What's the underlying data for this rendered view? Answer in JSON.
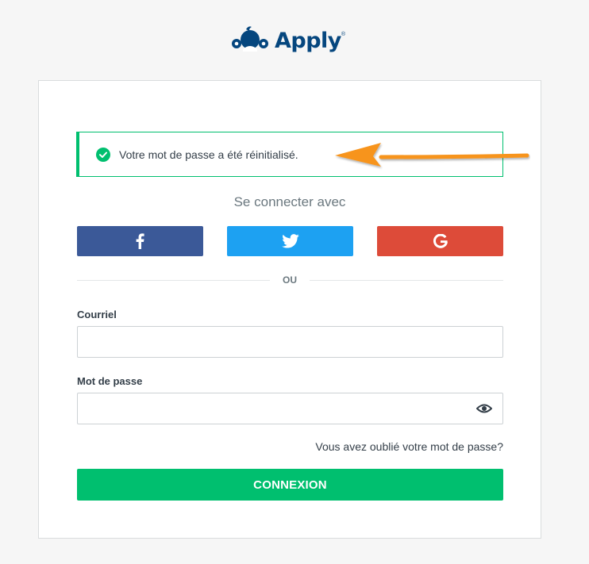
{
  "brand": {
    "name": "Apply",
    "reg_mark": "®",
    "logo_color": "#05467e"
  },
  "alert": {
    "icon": "check-circle-icon",
    "message": "Votre mot de passe a été réinitialisé.",
    "color": "#00bf6f"
  },
  "annotation": {
    "icon": "orange-arrow",
    "color": "#f7941d"
  },
  "login": {
    "heading": "Se connecter avec",
    "social": [
      {
        "name": "facebook",
        "icon": "facebook-icon",
        "color": "#3b5998"
      },
      {
        "name": "twitter",
        "icon": "twitter-icon",
        "color": "#1da1f2"
      },
      {
        "name": "google",
        "icon": "google-icon",
        "color": "#dd4b39"
      }
    ],
    "divider": "OU",
    "email_label": "Courriel",
    "email_value": "",
    "password_label": "Mot de passe",
    "password_value": "",
    "password_toggle_icon": "eye-icon",
    "forgot_link": "Vous avez oublié votre mot de passe?",
    "submit_label": "CONNEXION",
    "submit_color": "#00bf6f"
  }
}
